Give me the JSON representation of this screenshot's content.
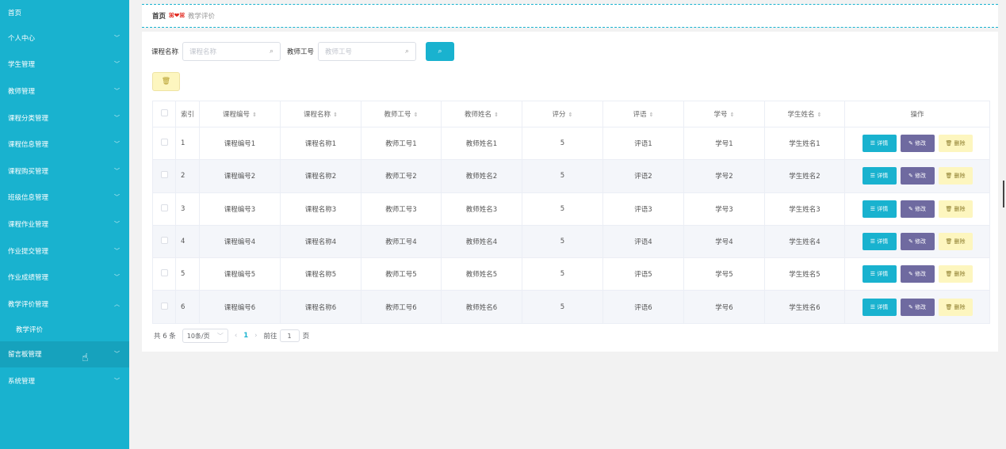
{
  "sidebar": {
    "items": [
      {
        "label": "首页",
        "chev": ""
      },
      {
        "label": "个人中心",
        "chev": "﹀"
      },
      {
        "label": "学生管理",
        "chev": "﹀"
      },
      {
        "label": "教师管理",
        "chev": "﹀"
      },
      {
        "label": "课程分类管理",
        "chev": "﹀"
      },
      {
        "label": "课程信息管理",
        "chev": "﹀"
      },
      {
        "label": "课程购买管理",
        "chev": "﹀"
      },
      {
        "label": "班级信息管理",
        "chev": "﹀"
      },
      {
        "label": "课程作业管理",
        "chev": "﹀"
      },
      {
        "label": "作业提交管理",
        "chev": "﹀"
      },
      {
        "label": "作业成绩管理",
        "chev": "﹀"
      },
      {
        "label": "教学评价管理",
        "chev": "︿"
      }
    ],
    "sub_item": "教学评价",
    "after_items": [
      {
        "label": "留言板管理",
        "chev": "﹀"
      },
      {
        "label": "系统管理",
        "chev": "﹀"
      }
    ]
  },
  "breadcrumb": {
    "home": "首页",
    "sep": "ꕤ❤ꕤ",
    "current": "教学评价"
  },
  "search": {
    "course_name_label": "课程名称",
    "course_name_placeholder": "课程名称",
    "teacher_id_label": "教师工号",
    "teacher_id_placeholder": "教师工号",
    "search_icon": "⌕",
    "delete_icon": "🗑"
  },
  "table": {
    "headers": {
      "index": "索引",
      "course_code": "课程编号",
      "course_name": "课程名称",
      "teacher_id": "教师工号",
      "teacher_name": "教师姓名",
      "score": "评分",
      "comment": "评语",
      "student_id": "学号",
      "student_name": "学生姓名",
      "ops": "操作",
      "sort": "⇕"
    },
    "rows": [
      {
        "index": "1",
        "course_code": "课程编号1",
        "course_name": "课程名称1",
        "teacher_id": "教师工号1",
        "teacher_name": "教师姓名1",
        "score": "5",
        "comment": "评语1",
        "student_id": "学号1",
        "student_name": "学生姓名1"
      },
      {
        "index": "2",
        "course_code": "课程编号2",
        "course_name": "课程名称2",
        "teacher_id": "教师工号2",
        "teacher_name": "教师姓名2",
        "score": "5",
        "comment": "评语2",
        "student_id": "学号2",
        "student_name": "学生姓名2"
      },
      {
        "index": "3",
        "course_code": "课程编号3",
        "course_name": "课程名称3",
        "teacher_id": "教师工号3",
        "teacher_name": "教师姓名3",
        "score": "5",
        "comment": "评语3",
        "student_id": "学号3",
        "student_name": "学生姓名3"
      },
      {
        "index": "4",
        "course_code": "课程编号4",
        "course_name": "课程名称4",
        "teacher_id": "教师工号4",
        "teacher_name": "教师姓名4",
        "score": "5",
        "comment": "评语4",
        "student_id": "学号4",
        "student_name": "学生姓名4"
      },
      {
        "index": "5",
        "course_code": "课程编号5",
        "course_name": "课程名称5",
        "teacher_id": "教师工号5",
        "teacher_name": "教师姓名5",
        "score": "5",
        "comment": "评语5",
        "student_id": "学号5",
        "student_name": "学生姓名5"
      },
      {
        "index": "6",
        "course_code": "课程编号6",
        "course_name": "课程名称6",
        "teacher_id": "教师工号6",
        "teacher_name": "教师姓名6",
        "score": "5",
        "comment": "评语6",
        "student_id": "学号6",
        "student_name": "学生姓名6"
      }
    ],
    "ops": {
      "detail": "☰ 详情",
      "edit": "✎ 修改",
      "delete": "🗑 删除"
    }
  },
  "pager": {
    "total": "共 6 条",
    "page_size": "10条/页",
    "prev": "‹",
    "page": "1",
    "next": "›",
    "goto_prefix": "前往",
    "goto_value": "1",
    "goto_suffix": "页"
  },
  "colors": {
    "sidebar": "#19b2cf",
    "primary": "#19b2cf",
    "edit": "#6f6aa0",
    "warn_bg": "#fdf6bf"
  }
}
